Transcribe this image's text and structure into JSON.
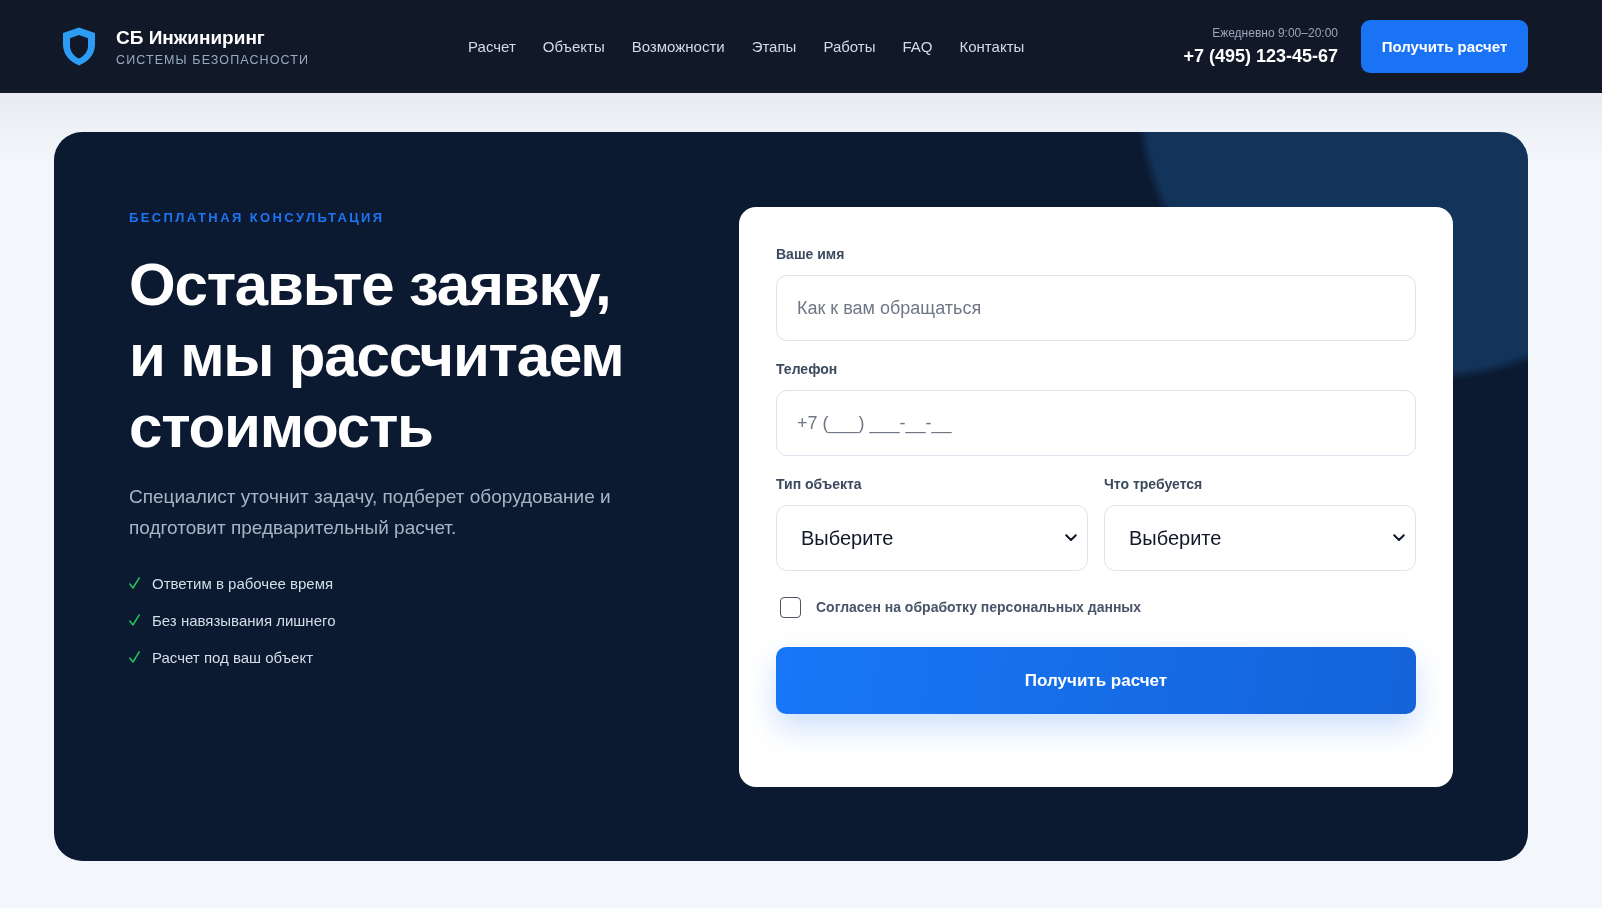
{
  "header": {
    "brand": {
      "name": "СБ Инжиниринг",
      "tagline": "СИСТЕМЫ БЕЗОПАСНОСТИ"
    },
    "nav": [
      "Расчет",
      "Объекты",
      "Возможности",
      "Этапы",
      "Работы",
      "FAQ",
      "Контакты"
    ],
    "hours": "Ежедневно 9:00–20:00",
    "phone": "+7 (495) 123-45-67",
    "cta_button": "Получить расчет"
  },
  "hero": {
    "eyebrow": "БЕСПЛАТНАЯ КОНСУЛЬТАЦИЯ",
    "title": "Оставьте заявку, и мы рассчитаем стоимость",
    "lead": "Специалист уточнит задачу, подберет оборудование и подготовит предварительный расчет.",
    "benefits": [
      "Ответим в рабочее время",
      "Без навязывания лишнего",
      "Расчет под ваш объект"
    ]
  },
  "form": {
    "fields": [
      {
        "label": "Ваше имя",
        "placeholder": "Как к вам обращаться"
      },
      {
        "label": "Телефон",
        "placeholder": "+7 (___) ___-__-__"
      }
    ],
    "selects": [
      {
        "label": "Тип объекта",
        "value": "Выберите"
      },
      {
        "label": "Что требуется",
        "value": "Выберите"
      }
    ],
    "consent": {
      "label": "Согласен на обработку персональных данных",
      "checked": false
    },
    "submit": "Получить расчет"
  }
}
